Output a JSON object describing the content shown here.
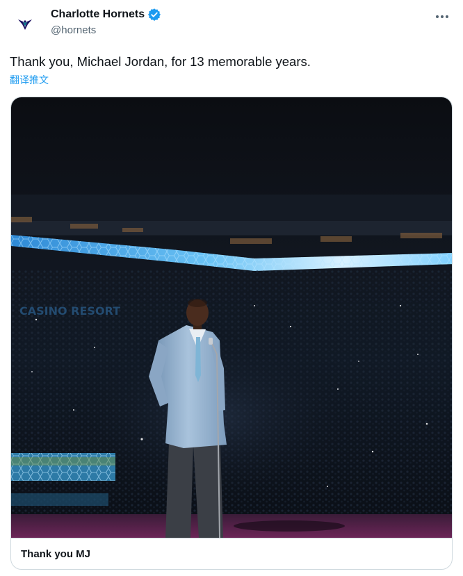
{
  "tweet": {
    "author": {
      "display_name": "Charlotte Hornets",
      "handle": "@hornets",
      "verified": true,
      "avatar_icon": "hornets-logo-icon"
    },
    "text": "Thank you, Michael Jordan, for 13 memorable years.",
    "translate_label": "翻译推文",
    "more_icon": "more-icon",
    "card": {
      "title": "Thank you MJ",
      "image": {
        "arena_sign": "CASINO RESORT"
      }
    }
  },
  "colors": {
    "text": "#0f1419",
    "secondary": "#536471",
    "link": "#1d9bf0",
    "verified": "#1d9bf0",
    "border": "#cfd9de",
    "ribbon": "#3fa3e6"
  }
}
